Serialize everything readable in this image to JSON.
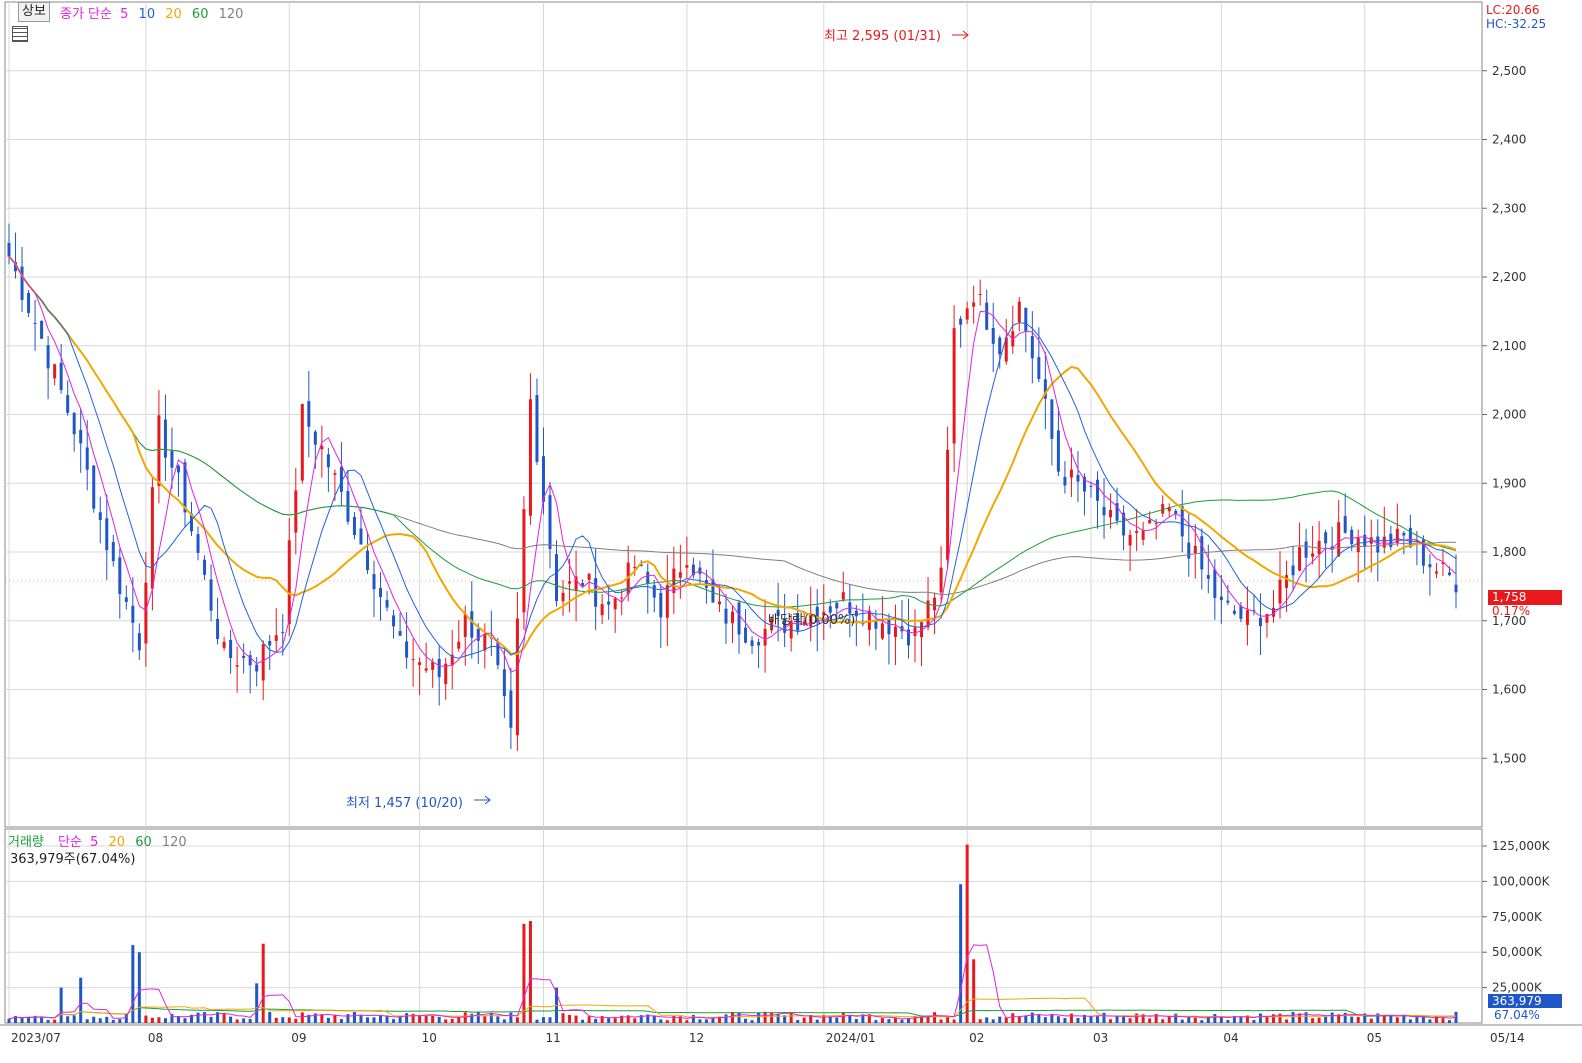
{
  "toolbar": {
    "period_button": "상보"
  },
  "price_legend": {
    "label": "종가 단순",
    "ma": [
      {
        "label": "5",
        "color": "#e024e0"
      },
      {
        "label": "10",
        "color": "#1f63e0"
      },
      {
        "label": "20",
        "color": "#f0a800"
      },
      {
        "label": "60",
        "color": "#1b9e3a"
      },
      {
        "label": "120",
        "color": "#808080"
      }
    ]
  },
  "volume_legend": {
    "label": "거래량",
    "simple": "단순",
    "ma": [
      {
        "label": "5",
        "color": "#e024e0"
      },
      {
        "label": "20",
        "color": "#f0a800"
      },
      {
        "label": "60",
        "color": "#1b9e3a"
      },
      {
        "label": "120",
        "color": "#808080"
      }
    ],
    "current": "363,979주(67.04%)"
  },
  "corner": {
    "lc": "LC:20.66",
    "hc": "HC:-32.25"
  },
  "annotations": {
    "high": "최고 2,595 (01/31)",
    "low": "최저 1,457 (10/20)",
    "dividend": "배당락(0.00%)"
  },
  "current_price": {
    "value": "1,758",
    "change": "0.17%"
  },
  "current_volume": {
    "value": "363,979",
    "ratio": "67.04%"
  },
  "colors": {
    "up": "#e8191c",
    "down": "#1f56c8",
    "grid": "#d8d8d8"
  },
  "chart_data": {
    "type": "candlestick",
    "price_axis": {
      "ticks": [
        "2,500",
        "2,400",
        "2,300",
        "2,200",
        "2,100",
        "2,000",
        "1,900",
        "1,800",
        "1,700",
        "1,600",
        "1,500"
      ],
      "ylim": [
        1400,
        2600
      ]
    },
    "volume_axis": {
      "ticks": [
        "125,000K",
        "100,000K",
        "75,000K",
        "50,000K",
        "25,000K"
      ]
    },
    "x_labels": [
      "2023/07",
      "08",
      "09",
      "10",
      "11",
      "12",
      "2024/01",
      "02",
      "03",
      "04",
      "05",
      "05/14"
    ],
    "high": {
      "value": 2595,
      "date": "01/31"
    },
    "low": {
      "value": 1457,
      "date": "10/20"
    },
    "last_close": 1758,
    "last_volume": 363979
  }
}
